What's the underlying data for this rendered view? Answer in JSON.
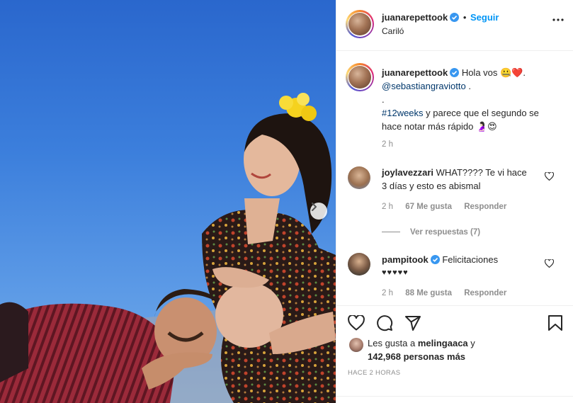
{
  "post": {
    "username": "juanarepettook",
    "follow_label": "Seguir",
    "location": "Cariló",
    "caption_lines": [
      "Hola vos 🤐❤️.",
      "@sebastiangraviotto",
      ".",
      "#12weeks",
      "y parece que el segundo se",
      "hace notar más rápido 🤰🏻😍"
    ],
    "caption_time": "2 h"
  },
  "comments": [
    {
      "username": "joylavezzari",
      "text_line1": "WHAT???? Te vi hace",
      "text_line2": "3 días y esto es abismal",
      "time": "2 h",
      "likes": "67 Me gusta",
      "reply_label": "Responder",
      "view_replies": "Ver respuestas (7)"
    },
    {
      "username": "pampitook",
      "text_line1": "Felicitaciones",
      "text_line2": "♥♥♥♥♥",
      "time": "2 h",
      "likes": "88 Me gusta",
      "reply_label": "Responder"
    }
  ],
  "likes": {
    "prefix": "Les gusta a",
    "first_user": "melingaaca",
    "conj": "y",
    "others": "142,968 personas más"
  },
  "posted_time": "HACE 2 HORAS",
  "icons": {
    "like": "heart-icon",
    "comment": "comment-icon",
    "share": "share-icon",
    "save": "bookmark-icon",
    "more": "more-options-icon",
    "next": "chevron-right-icon",
    "verified": "verified-badge-icon"
  },
  "colors": {
    "accent": "#0095f6",
    "link": "#00376b",
    "secondary_text": "#8e8e8e",
    "verified": "#3897f0"
  }
}
